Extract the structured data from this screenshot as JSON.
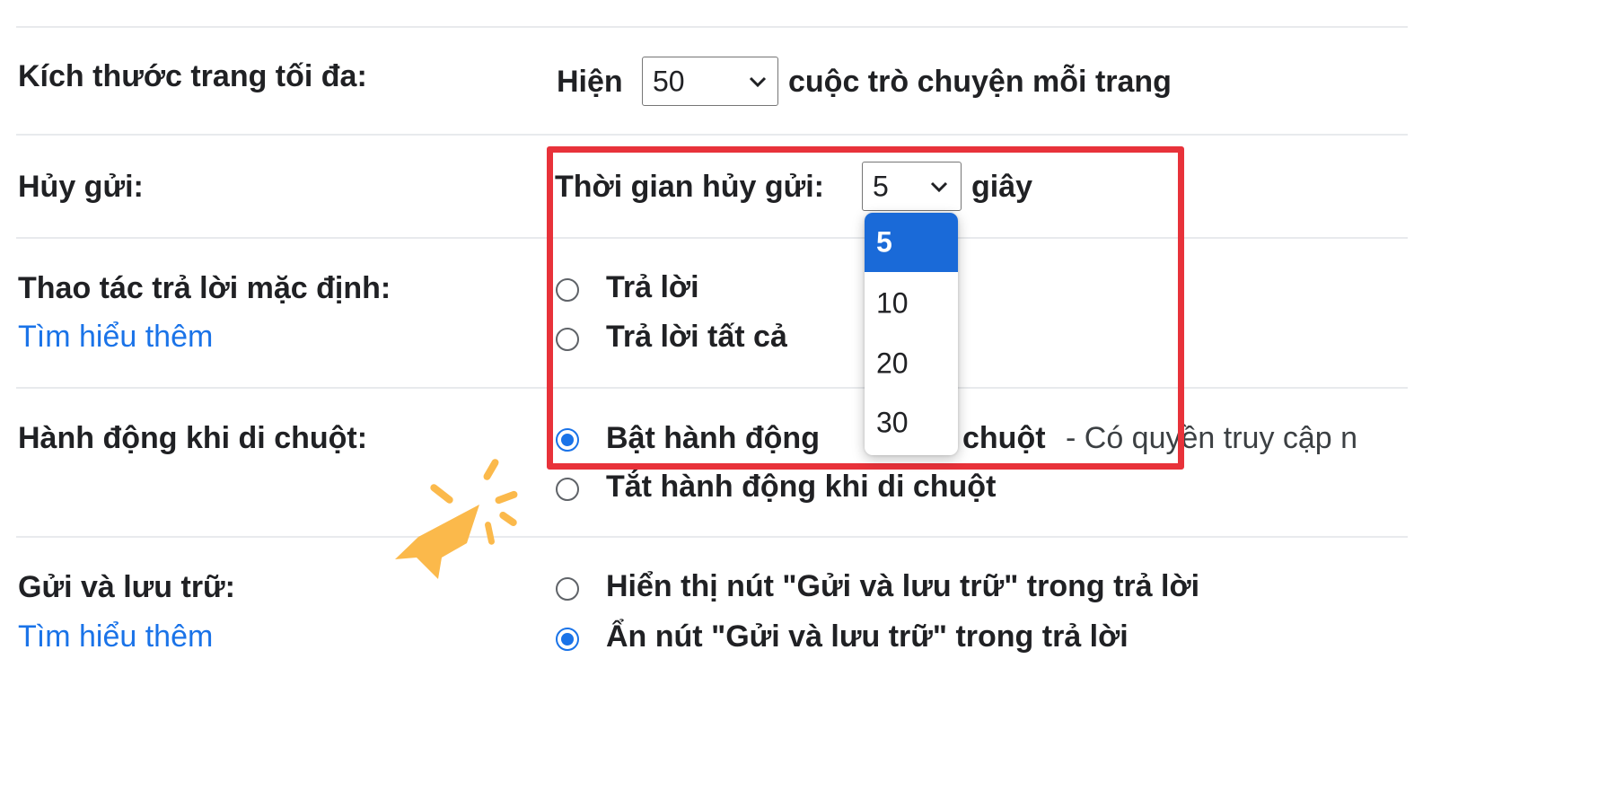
{
  "page_size": {
    "label": "Kích thước trang tối đa:",
    "prefix": "Hiện",
    "value": "50",
    "suffix": "cuộc trò chuyện mỗi trang"
  },
  "undo_send": {
    "label": "Hủy gửi:",
    "prefix": "Thời gian hủy gửi:",
    "value": "5",
    "suffix": "giây",
    "options": [
      "5",
      "10",
      "20",
      "30"
    ],
    "selected_option": "5"
  },
  "reply_default": {
    "label": "Thao tác trả lời mặc định:",
    "learn_more": "Tìm hiểu thêm",
    "options": [
      {
        "label": "Trả lời",
        "checked": false
      },
      {
        "label": "Trả lời tất cả",
        "checked": false
      }
    ]
  },
  "hover_actions": {
    "label": "Hành động khi di chuột:",
    "options": [
      {
        "label": "Bật hành động khi di chuột",
        "checked": true,
        "visible_parts": [
          "Bật hành động",
          "chuột"
        ],
        "description": "- Có quyền truy cập n"
      },
      {
        "label": "Tắt hành động khi di chuột",
        "checked": false
      }
    ]
  },
  "send_archive": {
    "label": "Gửi và lưu trữ:",
    "learn_more": "Tìm hiểu thêm",
    "options": [
      {
        "label": "Hiển thị nút \"Gửi và lưu trữ\" trong trả lời",
        "checked": false
      },
      {
        "label": "Ẩn nút \"Gửi và lưu trữ\" trong trả lời",
        "checked": true
      }
    ]
  },
  "colors": {
    "highlight": "#e8323a",
    "accent": "#1a73e8",
    "cursor": "#fbb94b"
  },
  "icons": [
    "chevron-down-icon",
    "click-cursor-icon"
  ]
}
